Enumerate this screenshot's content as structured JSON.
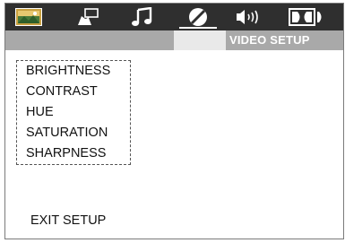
{
  "toolbar": {
    "tabs": [
      {
        "icon": "general-setup-icon",
        "active": false
      },
      {
        "icon": "language-setup-icon",
        "active": false
      },
      {
        "icon": "audio-setup-icon",
        "active": false
      },
      {
        "icon": "video-setup-icon",
        "active": true
      },
      {
        "icon": "speaker-setup-icon",
        "active": false
      },
      {
        "icon": "dolby-digital-setup-icon",
        "active": false
      }
    ],
    "bar_color": "#2f2f2f"
  },
  "header": {
    "title": "VIDEO SETUP",
    "bar_color": "#a9a9a9"
  },
  "menu": {
    "items": [
      {
        "label": "BRIGHTNESS"
      },
      {
        "label": "CONTRAST"
      },
      {
        "label": "HUE"
      },
      {
        "label": "SATURATION"
      },
      {
        "label": "SHARPNESS"
      }
    ]
  },
  "exit": {
    "label": "EXIT SETUP"
  }
}
